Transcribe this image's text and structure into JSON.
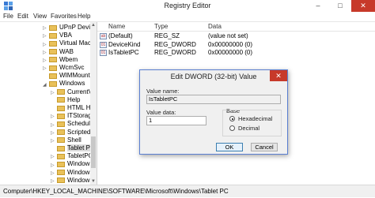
{
  "window": {
    "title": "Registry Editor",
    "controls": {
      "minimize": "–",
      "maximize": "□",
      "close": "✕"
    }
  },
  "menu": [
    "File",
    "Edit",
    "View",
    "Favorites",
    "Help"
  ],
  "tree": {
    "items": [
      {
        "label": "UPnP Device H",
        "expander": "▷",
        "selected": false
      },
      {
        "label": "VBA",
        "expander": "▷",
        "selected": false
      },
      {
        "label": "Virtual Machin",
        "expander": "▷",
        "selected": false
      },
      {
        "label": "WAB",
        "expander": "▷",
        "selected": false
      },
      {
        "label": "Wbem",
        "expander": "▷",
        "selected": false
      },
      {
        "label": "WcmSvc",
        "expander": "▷",
        "selected": false
      },
      {
        "label": "WIMMount",
        "expander": "",
        "selected": false
      },
      {
        "label": "Windows",
        "expander": "◢",
        "selected": false
      },
      {
        "label": "CurrentVer",
        "expander": "▷",
        "selected": false
      },
      {
        "label": "Help",
        "expander": "",
        "selected": false
      },
      {
        "label": "HTML Help",
        "expander": "",
        "selected": false
      },
      {
        "label": "ITStorage",
        "expander": "▷",
        "selected": false
      },
      {
        "label": "Scheduled",
        "expander": "▷",
        "selected": false
      },
      {
        "label": "ScriptedDi",
        "expander": "▷",
        "selected": false
      },
      {
        "label": "Shell",
        "expander": "▷",
        "selected": false
      },
      {
        "label": "Tablet PC",
        "expander": "",
        "selected": true
      },
      {
        "label": "TabletPC",
        "expander": "▷",
        "selected": false
      },
      {
        "label": "Windows E",
        "expander": "▷",
        "selected": false
      },
      {
        "label": "Windows S",
        "expander": "▷",
        "selected": false
      },
      {
        "label": "Windows Defe",
        "expander": "▷",
        "selected": false
      }
    ],
    "scroll_up": "▲",
    "scroll_down": "▼"
  },
  "list": {
    "columns": [
      "Name",
      "Type",
      "Data"
    ],
    "rows": [
      {
        "icon": "string-value-icon",
        "icon_text": "ab",
        "name": "(Default)",
        "type": "REG_SZ",
        "data": "(value not set)"
      },
      {
        "icon": "dword-value-icon",
        "icon_text": "01",
        "name": "DeviceKind",
        "type": "REG_DWORD",
        "data": "0x00000000 (0)"
      },
      {
        "icon": "dword-value-icon",
        "icon_text": "01",
        "name": "IsTabletPC",
        "type": "REG_DWORD",
        "data": "0x00000000 (0)"
      }
    ]
  },
  "status": {
    "path": "Computer\\HKEY_LOCAL_MACHINE\\SOFTWARE\\Microsoft\\Windows\\Tablet PC"
  },
  "dialog": {
    "title": "Edit DWORD (32-bit) Value",
    "close": "✕",
    "value_name_label": "Value name:",
    "value_name": "IsTabletPC",
    "value_data_label": "Value data:",
    "value_data": "1",
    "base_label": "Base",
    "base_options": [
      "Hexadecimal",
      "Decimal"
    ],
    "base_selected": "Hexadecimal",
    "ok_label": "OK",
    "cancel_label": "Cancel"
  }
}
